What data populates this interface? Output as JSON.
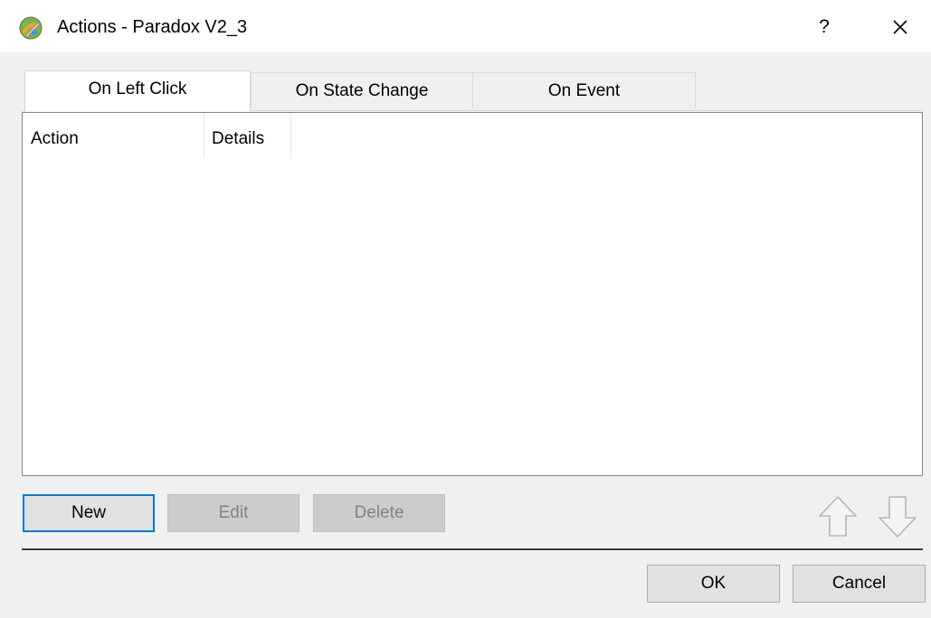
{
  "window": {
    "title": "Actions - Paradox V2_3",
    "help_label": "?"
  },
  "tabs": [
    {
      "label": "On Left Click",
      "active": true
    },
    {
      "label": "On State Change",
      "active": false
    },
    {
      "label": "On Event",
      "active": false
    }
  ],
  "table": {
    "columns": [
      "Action",
      "Details"
    ],
    "rows": []
  },
  "buttons": {
    "new_label": "New",
    "edit_label": "Edit",
    "delete_label": "Delete",
    "ok_label": "OK",
    "cancel_label": "Cancel"
  },
  "icons": {
    "app": "app-icon",
    "help": "help-icon",
    "close": "close-icon",
    "move_up": "arrow-up-icon",
    "move_down": "arrow-down-icon"
  },
  "colors": {
    "default_button_border": "#0078d7",
    "disabled_button_bg": "#cccccc"
  }
}
